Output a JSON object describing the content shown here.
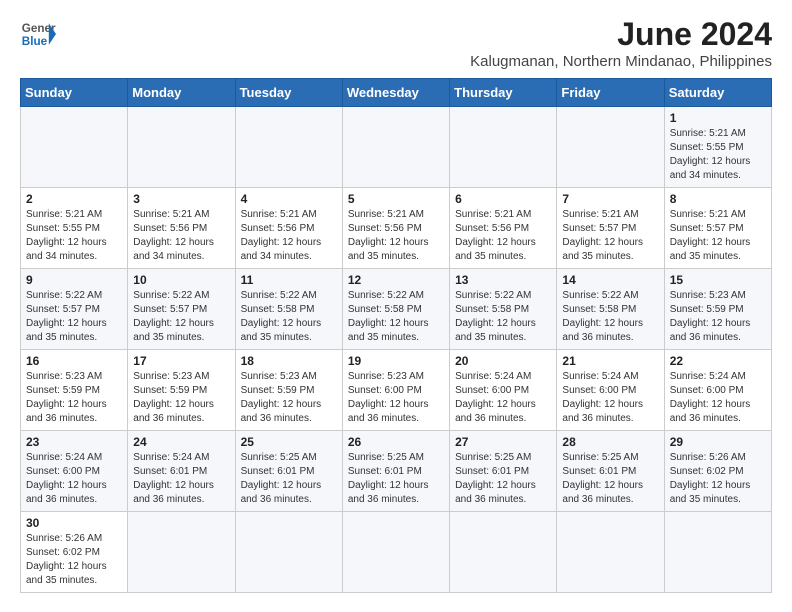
{
  "header": {
    "logo_line1": "General",
    "logo_line2": "Blue",
    "title": "June 2024",
    "subtitle": "Kalugmanan, Northern Mindanao, Philippines"
  },
  "weekdays": [
    "Sunday",
    "Monday",
    "Tuesday",
    "Wednesday",
    "Thursday",
    "Friday",
    "Saturday"
  ],
  "weeks": [
    [
      {
        "day": "",
        "info": ""
      },
      {
        "day": "",
        "info": ""
      },
      {
        "day": "",
        "info": ""
      },
      {
        "day": "",
        "info": ""
      },
      {
        "day": "",
        "info": ""
      },
      {
        "day": "",
        "info": ""
      },
      {
        "day": "1",
        "info": "Sunrise: 5:21 AM\nSunset: 5:55 PM\nDaylight: 12 hours\nand 34 minutes."
      }
    ],
    [
      {
        "day": "2",
        "info": "Sunrise: 5:21 AM\nSunset: 5:55 PM\nDaylight: 12 hours\nand 34 minutes."
      },
      {
        "day": "3",
        "info": "Sunrise: 5:21 AM\nSunset: 5:56 PM\nDaylight: 12 hours\nand 34 minutes."
      },
      {
        "day": "4",
        "info": "Sunrise: 5:21 AM\nSunset: 5:56 PM\nDaylight: 12 hours\nand 34 minutes."
      },
      {
        "day": "5",
        "info": "Sunrise: 5:21 AM\nSunset: 5:56 PM\nDaylight: 12 hours\nand 35 minutes."
      },
      {
        "day": "6",
        "info": "Sunrise: 5:21 AM\nSunset: 5:56 PM\nDaylight: 12 hours\nand 35 minutes."
      },
      {
        "day": "7",
        "info": "Sunrise: 5:21 AM\nSunset: 5:57 PM\nDaylight: 12 hours\nand 35 minutes."
      },
      {
        "day": "8",
        "info": "Sunrise: 5:21 AM\nSunset: 5:57 PM\nDaylight: 12 hours\nand 35 minutes."
      }
    ],
    [
      {
        "day": "9",
        "info": "Sunrise: 5:22 AM\nSunset: 5:57 PM\nDaylight: 12 hours\nand 35 minutes."
      },
      {
        "day": "10",
        "info": "Sunrise: 5:22 AM\nSunset: 5:57 PM\nDaylight: 12 hours\nand 35 minutes."
      },
      {
        "day": "11",
        "info": "Sunrise: 5:22 AM\nSunset: 5:58 PM\nDaylight: 12 hours\nand 35 minutes."
      },
      {
        "day": "12",
        "info": "Sunrise: 5:22 AM\nSunset: 5:58 PM\nDaylight: 12 hours\nand 35 minutes."
      },
      {
        "day": "13",
        "info": "Sunrise: 5:22 AM\nSunset: 5:58 PM\nDaylight: 12 hours\nand 35 minutes."
      },
      {
        "day": "14",
        "info": "Sunrise: 5:22 AM\nSunset: 5:58 PM\nDaylight: 12 hours\nand 36 minutes."
      },
      {
        "day": "15",
        "info": "Sunrise: 5:23 AM\nSunset: 5:59 PM\nDaylight: 12 hours\nand 36 minutes."
      }
    ],
    [
      {
        "day": "16",
        "info": "Sunrise: 5:23 AM\nSunset: 5:59 PM\nDaylight: 12 hours\nand 36 minutes."
      },
      {
        "day": "17",
        "info": "Sunrise: 5:23 AM\nSunset: 5:59 PM\nDaylight: 12 hours\nand 36 minutes."
      },
      {
        "day": "18",
        "info": "Sunrise: 5:23 AM\nSunset: 5:59 PM\nDaylight: 12 hours\nand 36 minutes."
      },
      {
        "day": "19",
        "info": "Sunrise: 5:23 AM\nSunset: 6:00 PM\nDaylight: 12 hours\nand 36 minutes."
      },
      {
        "day": "20",
        "info": "Sunrise: 5:24 AM\nSunset: 6:00 PM\nDaylight: 12 hours\nand 36 minutes."
      },
      {
        "day": "21",
        "info": "Sunrise: 5:24 AM\nSunset: 6:00 PM\nDaylight: 12 hours\nand 36 minutes."
      },
      {
        "day": "22",
        "info": "Sunrise: 5:24 AM\nSunset: 6:00 PM\nDaylight: 12 hours\nand 36 minutes."
      }
    ],
    [
      {
        "day": "23",
        "info": "Sunrise: 5:24 AM\nSunset: 6:00 PM\nDaylight: 12 hours\nand 36 minutes."
      },
      {
        "day": "24",
        "info": "Sunrise: 5:24 AM\nSunset: 6:01 PM\nDaylight: 12 hours\nand 36 minutes."
      },
      {
        "day": "25",
        "info": "Sunrise: 5:25 AM\nSunset: 6:01 PM\nDaylight: 12 hours\nand 36 minutes."
      },
      {
        "day": "26",
        "info": "Sunrise: 5:25 AM\nSunset: 6:01 PM\nDaylight: 12 hours\nand 36 minutes."
      },
      {
        "day": "27",
        "info": "Sunrise: 5:25 AM\nSunset: 6:01 PM\nDaylight: 12 hours\nand 36 minutes."
      },
      {
        "day": "28",
        "info": "Sunrise: 5:25 AM\nSunset: 6:01 PM\nDaylight: 12 hours\nand 36 minutes."
      },
      {
        "day": "29",
        "info": "Sunrise: 5:26 AM\nSunset: 6:02 PM\nDaylight: 12 hours\nand 35 minutes."
      }
    ],
    [
      {
        "day": "30",
        "info": "Sunrise: 5:26 AM\nSunset: 6:02 PM\nDaylight: 12 hours\nand 35 minutes."
      },
      {
        "day": "",
        "info": ""
      },
      {
        "day": "",
        "info": ""
      },
      {
        "day": "",
        "info": ""
      },
      {
        "day": "",
        "info": ""
      },
      {
        "day": "",
        "info": ""
      },
      {
        "day": "",
        "info": ""
      }
    ]
  ]
}
